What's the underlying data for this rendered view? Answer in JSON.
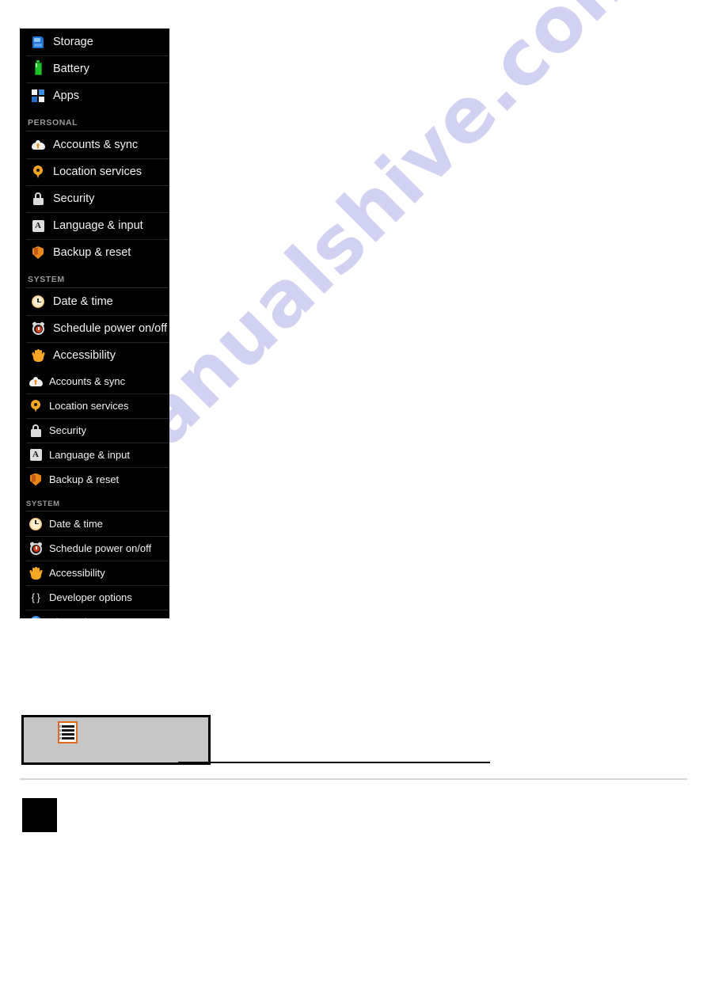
{
  "page": {
    "watermark_text": "manualshive.com",
    "watermark_color": "#cfcff2",
    "background_color": "#ffffff"
  },
  "settings_panel": {
    "background_color": "#000000",
    "text_color": "#f2f2f2",
    "section_header_color": "#9a9a9a",
    "blocks": [
      {
        "id": "block-upper",
        "rows": [
          {
            "type": "item",
            "label": "Storage",
            "icon": "storage-icon"
          },
          {
            "type": "item",
            "label": "Battery",
            "icon": "battery-icon"
          },
          {
            "type": "item",
            "label": "Apps",
            "icon": "apps-grid-icon"
          },
          {
            "type": "header",
            "label": "PERSONAL"
          },
          {
            "type": "item",
            "label": "Accounts & sync",
            "icon": "cloud-sync-icon"
          },
          {
            "type": "item",
            "label": "Location services",
            "icon": "location-pin-icon"
          },
          {
            "type": "item",
            "label": "Security",
            "icon": "lock-icon"
          },
          {
            "type": "item",
            "label": "Language & input",
            "icon": "language-a-icon"
          },
          {
            "type": "item",
            "label": "Backup & reset",
            "icon": "shield-icon"
          },
          {
            "type": "header",
            "label": "SYSTEM"
          },
          {
            "type": "item",
            "label": "Date & time",
            "icon": "clock-icon"
          },
          {
            "type": "item",
            "label": "Schedule power on/off",
            "icon": "alarm-clock-icon"
          },
          {
            "type": "item",
            "label": "Accessibility",
            "icon": "hand-icon"
          }
        ]
      },
      {
        "id": "block-lower",
        "rows": [
          {
            "type": "item",
            "label": "Accounts & sync",
            "icon": "cloud-sync-icon"
          },
          {
            "type": "item",
            "label": "Location services",
            "icon": "location-pin-icon"
          },
          {
            "type": "item",
            "label": "Security",
            "icon": "lock-icon"
          },
          {
            "type": "item",
            "label": "Language & input",
            "icon": "language-a-icon"
          },
          {
            "type": "item",
            "label": "Backup & reset",
            "icon": "shield-icon"
          },
          {
            "type": "header",
            "label": "SYSTEM"
          },
          {
            "type": "item",
            "label": "Date & time",
            "icon": "clock-icon"
          },
          {
            "type": "item",
            "label": "Schedule power on/off",
            "icon": "alarm-clock-icon"
          },
          {
            "type": "item",
            "label": "Accessibility",
            "icon": "hand-icon"
          },
          {
            "type": "item",
            "label": "Developer options",
            "icon": "braces-icon"
          },
          {
            "type": "item",
            "label": "About phone",
            "icon": "info-icon"
          }
        ]
      }
    ]
  },
  "note_box": {
    "icon": "document-list-icon",
    "icon_border_color": "#e06a20",
    "background_color": "#c6c6c6",
    "border_color": "#000000",
    "redacted_lines": 2
  },
  "glyphs": {
    "language_letter": "A",
    "braces": "{ }",
    "info_letter": "i"
  }
}
